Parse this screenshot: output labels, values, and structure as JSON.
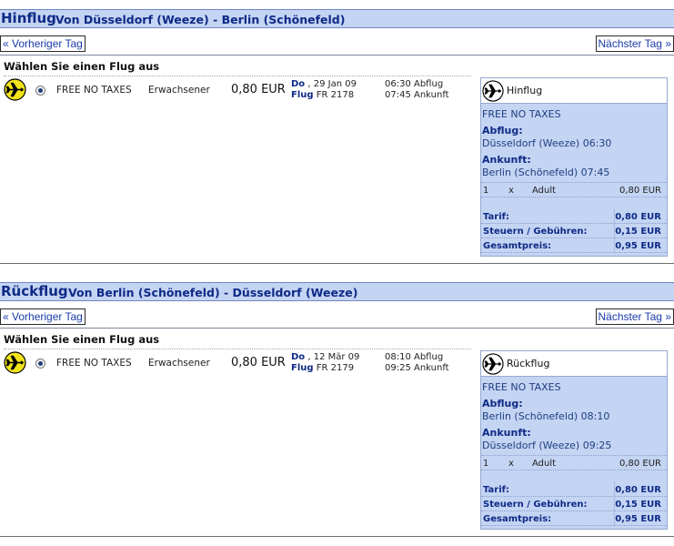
{
  "outbound": {
    "title_big": "Hinflug",
    "title_route": "Von Düsseldorf (Weeze) - Berlin (Schönefeld)",
    "prev_day": "« Vorheriger Tag",
    "next_day": "Nächster Tag »",
    "choose_label": "Wählen Sie einen Flug aus",
    "flight": {
      "fare_name": "FREE NO TAXES",
      "passenger_type": "Erwachsener",
      "price": "0,80 EUR",
      "day": "Do",
      "date": ", 29 Jan 09",
      "flight_label": "Flug",
      "flight_number": "FR 2178",
      "departure": "06:30 Abflug",
      "arrival": "07:45 Ankunft"
    },
    "summary": {
      "header": "Hinflug",
      "fare_name": "FREE NO TAXES",
      "departure_label": "Abflug:",
      "departure_value": "Düsseldorf (Weeze) 06:30",
      "arrival_label": "Ankunft:",
      "arrival_value": "Berlin (Schönefeld) 07:45",
      "pax_count": "1",
      "pax_x": "x",
      "pax_type": "Adult",
      "pax_price": "0,80 EUR",
      "tariff_label": "Tarif:",
      "tariff_value": "0,80 EUR",
      "taxes_label": "Steuern / Gebühren:",
      "taxes_value": "0,15 EUR",
      "total_label": "Gesamtpreis:",
      "total_value": "0,95 EUR"
    }
  },
  "return": {
    "title_big": "Rückflug",
    "title_route": "Von Berlin (Schönefeld) - Düsseldorf (Weeze)",
    "prev_day": "« Vorheriger Tag",
    "next_day": "Nächster Tag »",
    "choose_label": "Wählen Sie einen Flug aus",
    "flight": {
      "fare_name": "FREE NO TAXES",
      "passenger_type": "Erwachsener",
      "price": "0,80 EUR",
      "day": "Do",
      "date": ", 12 Mär 09",
      "flight_label": "Flug",
      "flight_number": "FR 2179",
      "departure": "08:10 Abflug",
      "arrival": "09:25 Ankunft"
    },
    "summary": {
      "header": "Rückflug",
      "fare_name": "FREE NO TAXES",
      "departure_label": "Abflug:",
      "departure_value": "Berlin (Schönefeld) 08:10",
      "arrival_label": "Ankunft:",
      "arrival_value": "Düsseldorf (Weeze) 09:25",
      "pax_count": "1",
      "pax_x": "x",
      "pax_type": "Adult",
      "pax_price": "0,80 EUR",
      "tariff_label": "Tarif:",
      "tariff_value": "0,80 EUR",
      "taxes_label": "Steuern / Gebühren:",
      "taxes_value": "0,15 EUR",
      "total_label": "Gesamtpreis:",
      "total_value": "0,95 EUR"
    }
  },
  "icons": {
    "flight_icon": "airplane-icon",
    "flight_icon_color": "#f3e31b",
    "summary_icon_color": "#ffffff"
  },
  "colors": {
    "header_bg": "#c4d4f3",
    "header_text": "#0e2a86",
    "link_text": "#1a3aa8"
  }
}
